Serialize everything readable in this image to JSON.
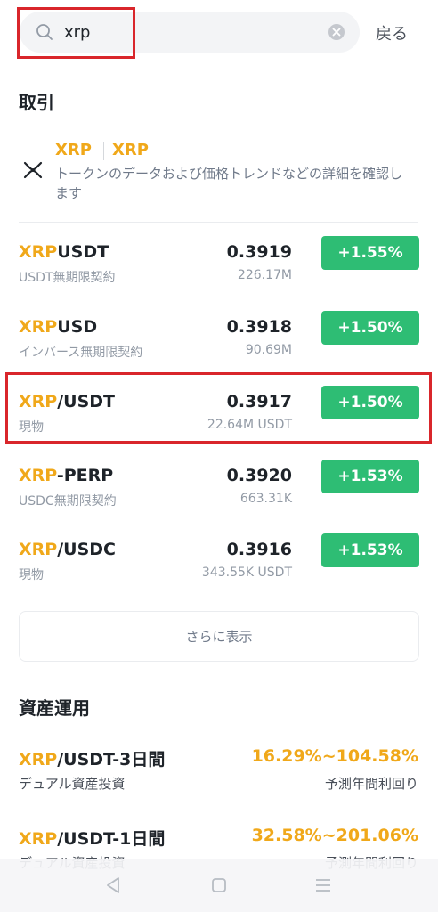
{
  "search": {
    "value": "xrp",
    "back_label": "戻る"
  },
  "trading": {
    "section_title": "取引",
    "token": {
      "symbol": "XRP",
      "name": "XRP",
      "description": "トークンのデータおよび価格トレンドなどの詳細を確認します"
    },
    "markets": [
      {
        "base": "XRP",
        "quote": "USDT",
        "type": "USDT無期限契約",
        "price": "0.3919",
        "volume": "226.17M",
        "change": "+1.55%"
      },
      {
        "base": "XRP",
        "quote": "USD",
        "type": "インバース無期限契約",
        "price": "0.3918",
        "volume": "90.69M",
        "change": "+1.50%"
      },
      {
        "base": "XRP",
        "quote": "/USDT",
        "type": "現物",
        "price": "0.3917",
        "volume": "22.64M USDT",
        "change": "+1.50%"
      },
      {
        "base": "XRP",
        "quote": "-PERP",
        "type": "USDC無期限契約",
        "price": "0.3920",
        "volume": "663.31K",
        "change": "+1.53%"
      },
      {
        "base": "XRP",
        "quote": "/USDC",
        "type": "現物",
        "price": "0.3916",
        "volume": "343.55K USDT",
        "change": "+1.53%"
      }
    ],
    "more_label": "さらに表示"
  },
  "earn": {
    "section_title": "資産運用",
    "products": [
      {
        "base": "XRP",
        "quote": "/USDT-3日間",
        "type": "デュアル資産投資",
        "rate": "16.29%~104.58%",
        "rate_label": "予測年間利回り"
      },
      {
        "base": "XRP",
        "quote": "/USDT-1日間",
        "type": "デュアル資産投資",
        "rate": "32.58%~201.06%",
        "rate_label": "予測年間利回り"
      }
    ]
  },
  "colors": {
    "accent": "#f0a81a",
    "positive": "#2ebd74",
    "highlight": "#d9262b"
  }
}
